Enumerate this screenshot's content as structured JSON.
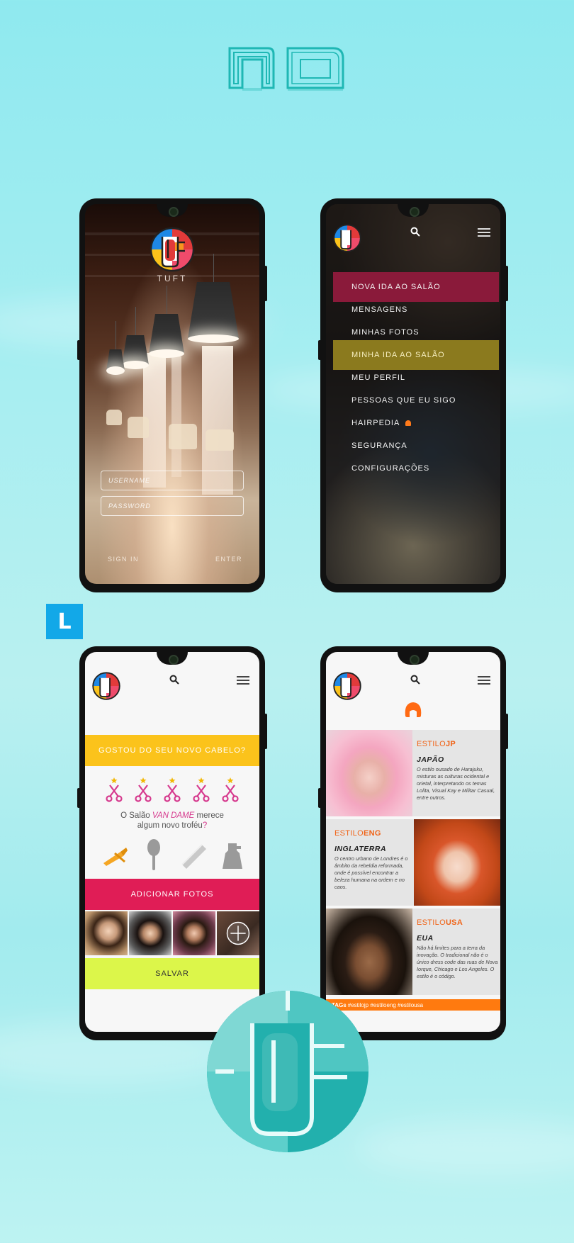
{
  "colors": {
    "teal": "#20b3b0",
    "accent_red": "#e01d56",
    "accent_yellow": "#fbc31b",
    "accent_lime": "#dcf64a",
    "accent_orange": "#f06418",
    "accent_pink": "#d63a8e",
    "badge_blue": "#12a8e8"
  },
  "badge": {
    "letter": "L"
  },
  "login": {
    "app_name": "TUFT",
    "username_placeholder": "USERNAME",
    "password_placeholder": "PASSWORD",
    "sign_in": "SIGN IN",
    "enter": "ENTER"
  },
  "menu": {
    "items": [
      {
        "label": "NOVA IDA AO SALÃO"
      },
      {
        "label": "MENSAGENS"
      },
      {
        "label": "MINHAS FOTOS"
      },
      {
        "label": "MINHA IDA AO SALÃO"
      },
      {
        "label": "MEU PERFIL"
      },
      {
        "label": "PESSOAS QUE EU SIGO"
      },
      {
        "label": "HAIRPEDIA"
      },
      {
        "label": "SEGURANÇA"
      },
      {
        "label": "CONFIGURAÇÕES"
      }
    ]
  },
  "rating": {
    "banner": "GOSTOU DO SEU NOVO CABELO?",
    "line1_prefix": "O Salão ",
    "salon_name": "VAN DAME",
    "line1_suffix": " merece",
    "line2": "algum novo troféu",
    "line2_mark": "?",
    "rating_stars": 5,
    "add_photos": "ADICIONAR FOTOS",
    "save": "SALVAR"
  },
  "styles": {
    "items": [
      {
        "prefix": "ESTILO",
        "code": "JP",
        "country": "JAPÃO",
        "description": "O estilo ousado de Harajuku, misturas as culturas ocidental e orietal, interpretando os temas Lolita, Visual Kay e Militar Casual, entre outros."
      },
      {
        "prefix": "ESTILO",
        "code": "ENG",
        "country": "INGLATERRA",
        "description": "O centro urbano de Londres é o âmbito da rebeldia reformada, onde é possível encontrar a beleza humana na ordem e no caos."
      },
      {
        "prefix": "ESTILO",
        "code": "USA",
        "country": "EUA",
        "description": "Não há limites para a terra da inovação. O tradicional não é o único dress code das ruas de Nova Iorque, Chicago e Los Angeles. O estilo é o código."
      }
    ],
    "tags_label": "TAGs",
    "tags": "#estilojp #estiloeng #estilousa"
  }
}
